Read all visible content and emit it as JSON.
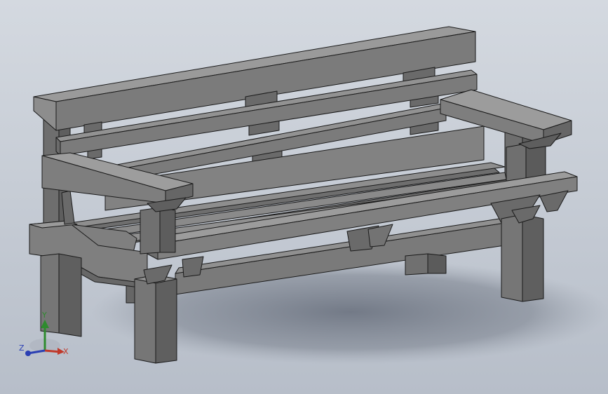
{
  "viewport": {
    "background_top": "#d4d9e0",
    "background_bottom": "#b7bec9",
    "part_color": "#7b7b7b",
    "part_light": "#8a8a8a",
    "part_dark": "#5e5e5e",
    "edge_color": "#1a1a1a",
    "shadow_color": "#7d8490"
  },
  "model": {
    "name": "bench-model"
  },
  "triad": {
    "y_label": "Y",
    "x_label": "X",
    "z_label": "Z",
    "y_color": "#2e8b2e",
    "x_color": "#c0392b",
    "z_color": "#2b3fb3",
    "icons": [
      "y-axis-icon",
      "x-axis-icon",
      "z-axis-icon"
    ]
  }
}
